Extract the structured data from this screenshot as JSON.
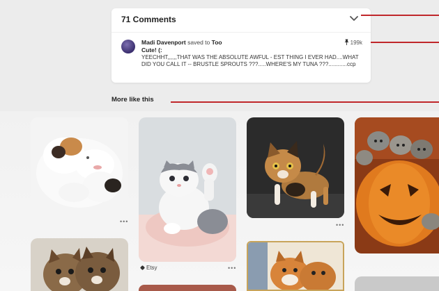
{
  "comments": {
    "count_label": "71 Comments",
    "user": "Madi Davenport",
    "saved_to_text": "saved to",
    "board": "Too",
    "pin_count": "199k",
    "title": "Cute! (:",
    "text": "YEECHHT,,,,,,THAT WAS THE ABSOLUTE AWFUL - EST THING I EVER HAD....WHAT DID YOU CALL IT -- BRUSTLE SPROUTS ???.....WHERE'S MY TUNA ???............ccp"
  },
  "more_like": {
    "heading": "More like this",
    "pins": [
      {
        "id": "kitten-sleeping",
        "source": "",
        "more_label": "•••"
      },
      {
        "id": "kitten-waving",
        "source": "Etsy",
        "more_label": "•••"
      },
      {
        "id": "kitten-tabby",
        "source": "",
        "more_label": "•••"
      },
      {
        "id": "kittens-pumpkin",
        "source": "",
        "more_label": ""
      },
      {
        "id": "kittens-pair",
        "source": "",
        "more_label": ""
      },
      {
        "id": "kitten-framed",
        "source": "",
        "more_label": ""
      }
    ]
  },
  "colors": {
    "annotation_line": "#c0262a",
    "card_bg": "#ffffff",
    "page_bg": "#ededed"
  },
  "icons": {
    "expand": "chevron-down-icon",
    "pin": "pin-icon",
    "source": "tag-icon"
  }
}
